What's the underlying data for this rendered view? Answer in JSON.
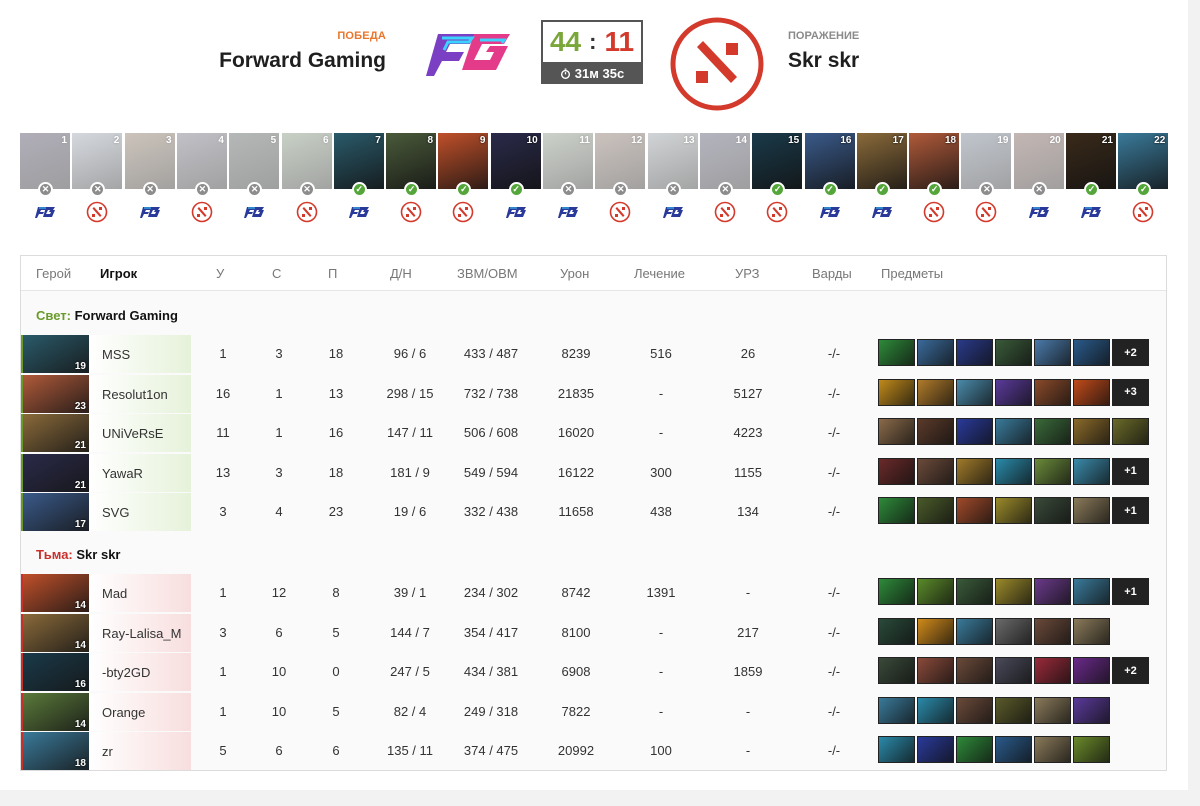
{
  "header": {
    "left": {
      "result": "ПОБЕДА",
      "name": "Forward Gaming"
    },
    "right": {
      "result": "ПОРАЖЕНИЕ",
      "name": "Skr skr"
    },
    "score": {
      "left": "44",
      "sep": ":",
      "right": "11",
      "time": "31м 35с"
    },
    "colors": {
      "win": "#7aa63a",
      "loss": "#d33a2c",
      "win_label": "#e8762c"
    }
  },
  "draft": [
    {
      "num": "1",
      "type": "ban",
      "team": "fg",
      "color": "#4a3a7a"
    },
    {
      "num": "2",
      "type": "ban",
      "team": "dota",
      "color": "#8fa6c8"
    },
    {
      "num": "3",
      "type": "ban",
      "team": "fg",
      "color": "#a0703a"
    },
    {
      "num": "4",
      "type": "ban",
      "team": "dota",
      "color": "#6a6a90"
    },
    {
      "num": "5",
      "type": "ban",
      "team": "fg",
      "color": "#4a5a5a"
    },
    {
      "num": "6",
      "type": "ban",
      "team": "dota",
      "color": "#6a9a5a"
    },
    {
      "num": "7",
      "type": "pick",
      "team": "fg",
      "color": "#2a5a6a"
    },
    {
      "num": "8",
      "type": "pick",
      "team": "dota",
      "color": "#4a5a3a"
    },
    {
      "num": "9",
      "type": "pick",
      "team": "dota",
      "color": "#c0502a"
    },
    {
      "num": "10",
      "type": "pick",
      "team": "fg",
      "color": "#2a2a4a"
    },
    {
      "num": "11",
      "type": "ban",
      "team": "fg",
      "color": "#7a9a6a"
    },
    {
      "num": "12",
      "type": "ban",
      "team": "dota",
      "color": "#a06a4a"
    },
    {
      "num": "13",
      "type": "ban",
      "team": "fg",
      "color": "#8a9aa8"
    },
    {
      "num": "14",
      "type": "ban",
      "team": "dota",
      "color": "#4a4a8a"
    },
    {
      "num": "15",
      "type": "pick",
      "team": "dota",
      "color": "#1a3a4a"
    },
    {
      "num": "16",
      "type": "pick",
      "team": "fg",
      "color": "#3a5a8a"
    },
    {
      "num": "17",
      "type": "pick",
      "team": "fg",
      "color": "#8a6a3a"
    },
    {
      "num": "18",
      "type": "pick",
      "team": "dota",
      "color": "#b05a3a"
    },
    {
      "num": "19",
      "type": "ban",
      "team": "dota",
      "color": "#5a7aa8"
    },
    {
      "num": "20",
      "type": "ban",
      "team": "fg",
      "color": "#9a4a3a"
    },
    {
      "num": "21",
      "type": "pick",
      "team": "fg",
      "color": "#3a2a1a"
    },
    {
      "num": "22",
      "type": "pick",
      "team": "dota",
      "color": "#3a7a9a"
    }
  ],
  "table": {
    "headers": {
      "hero": "Герой",
      "player": "Игрок",
      "k": "У",
      "d": "С",
      "a": "П",
      "lh": "Д/Н",
      "gpm": "ЗВМ/ОВМ",
      "dmg": "Урон",
      "heal": "Лечение",
      "bld": "УРЗ",
      "wards": "Варды",
      "items": "Предметы"
    },
    "radiant": {
      "label": "Свет:",
      "team": "Forward Gaming"
    },
    "dire": {
      "label": "Тьма:",
      "team": "Skr skr"
    },
    "radiant_rows": [
      {
        "level": "19",
        "player": "MSS",
        "k": "1",
        "d": "3",
        "a": "18",
        "lh": "96 / 6",
        "gpm": "433 / 487",
        "dmg": "8239",
        "heal": "516",
        "bld": "26",
        "wards": "-/-",
        "hero_color": "#2a5a6a",
        "items": [
          "#2e8a3a",
          "#3a6a9a",
          "#2a3a8a",
          "#3a5a3a",
          "#4a7aaa",
          "#2a5a8a",
          "#222"
        ],
        "more": "+2"
      },
      {
        "level": "23",
        "player": "Resolut1on",
        "k": "16",
        "d": "1",
        "a": "13",
        "lh": "298 / 15",
        "gpm": "732 / 738",
        "dmg": "21835",
        "heal": "-",
        "bld": "5127",
        "wards": "-/-",
        "hero_color": "#b05a3a",
        "items": [
          "#c08a1a",
          "#b07a2a",
          "#4a8aaa",
          "#5a3a9a",
          "#8a4a2a",
          "#c04a1a",
          "#222"
        ],
        "more": "+3"
      },
      {
        "level": "21",
        "player": "UNiVeRsE",
        "k": "11",
        "d": "1",
        "a": "16",
        "lh": "147 / 11",
        "gpm": "506 / 608",
        "dmg": "16020",
        "heal": "-",
        "bld": "4223",
        "wards": "-/-",
        "hero_color": "#8a6a3a",
        "items": [
          "#8a6a4a",
          "#5a3a2a",
          "#2a3a9a",
          "#3a7a9a",
          "#3a6a3a",
          "#8a6a2a",
          "#6a6a2a"
        ],
        "more": ""
      },
      {
        "level": "21",
        "player": "YawaR",
        "k": "13",
        "d": "3",
        "a": "18",
        "lh": "181 / 9",
        "gpm": "549 / 594",
        "dmg": "16122",
        "heal": "300",
        "bld": "1155",
        "wards": "-/-",
        "hero_color": "#2a2a4a",
        "items": [
          "#6a2a2a",
          "#6a4a3a",
          "#a07a2a",
          "#2a8aaa",
          "#6a8a3a",
          "#3a8aaa",
          "#222"
        ],
        "more": "+1"
      },
      {
        "level": "17",
        "player": "SVG",
        "k": "3",
        "d": "4",
        "a": "23",
        "lh": "19 / 6",
        "gpm": "332 / 438",
        "dmg": "11658",
        "heal": "438",
        "bld": "134",
        "wards": "-/-",
        "hero_color": "#3a5a8a",
        "items": [
          "#2e8a3a",
          "#4a5a2a",
          "#a04a2a",
          "#9a8a2a",
          "#3a4a3a",
          "#8a7a5a",
          "#222"
        ],
        "more": "+1"
      }
    ],
    "dire_rows": [
      {
        "level": "14",
        "player": "Mad",
        "k": "1",
        "d": "12",
        "a": "8",
        "lh": "39 / 1",
        "gpm": "234 / 302",
        "dmg": "8742",
        "heal": "1391",
        "bld": "-",
        "wards": "-/-",
        "hero_color": "#c0502a",
        "items": [
          "#2e8a3a",
          "#5a8a2a",
          "#3a5a3a",
          "#9a8a2a",
          "#6a3a8a",
          "#3a7a9a",
          "#222"
        ],
        "more": "+1"
      },
      {
        "level": "14",
        "player": "Ray-Lalisa_M",
        "k": "3",
        "d": "6",
        "a": "5",
        "lh": "144 / 7",
        "gpm": "354 / 417",
        "dmg": "8100",
        "heal": "-",
        "bld": "217",
        "wards": "-/-",
        "hero_color": "#8a6a3a",
        "items": [
          "#2a4a3a",
          "#d08a1a",
          "#3a7a9a",
          "#6a6a6a",
          "#6a4a3a",
          "#8a7a5a"
        ],
        "more": ""
      },
      {
        "level": "16",
        "player": "-bty2GD",
        "k": "1",
        "d": "10",
        "a": "0",
        "lh": "247 / 5",
        "gpm": "434 / 381",
        "dmg": "6908",
        "heal": "-",
        "bld": "1859",
        "wards": "-/-",
        "hero_color": "#1a3a4a",
        "items": [
          "#3a4a3a",
          "#8a4a3a",
          "#6a4a3a",
          "#4a4a5a",
          "#9a2a3a",
          "#6a2a8a",
          "#222"
        ],
        "more": "+2"
      },
      {
        "level": "14",
        "player": "Orange",
        "k": "1",
        "d": "10",
        "a": "5",
        "lh": "82 / 4",
        "gpm": "249 / 318",
        "dmg": "7822",
        "heal": "-",
        "bld": "-",
        "wards": "-/-",
        "hero_color": "#5a7a3a",
        "items": [
          "#3a7a9a",
          "#2a8aaa",
          "#6a4a3a",
          "#5a5a2a",
          "#8a7a5a",
          "#5a3a9a"
        ],
        "more": ""
      },
      {
        "level": "18",
        "player": "zr",
        "k": "5",
        "d": "6",
        "a": "6",
        "lh": "135 / 11",
        "gpm": "374 / 475",
        "dmg": "20992",
        "heal": "100",
        "bld": "-",
        "wards": "-/-",
        "hero_color": "#3a7a9a",
        "items": [
          "#2a8aaa",
          "#2a3a9a",
          "#2e8a3a",
          "#2a5a8a",
          "#8a7a5a",
          "#6a8a2a"
        ],
        "more": ""
      }
    ]
  }
}
